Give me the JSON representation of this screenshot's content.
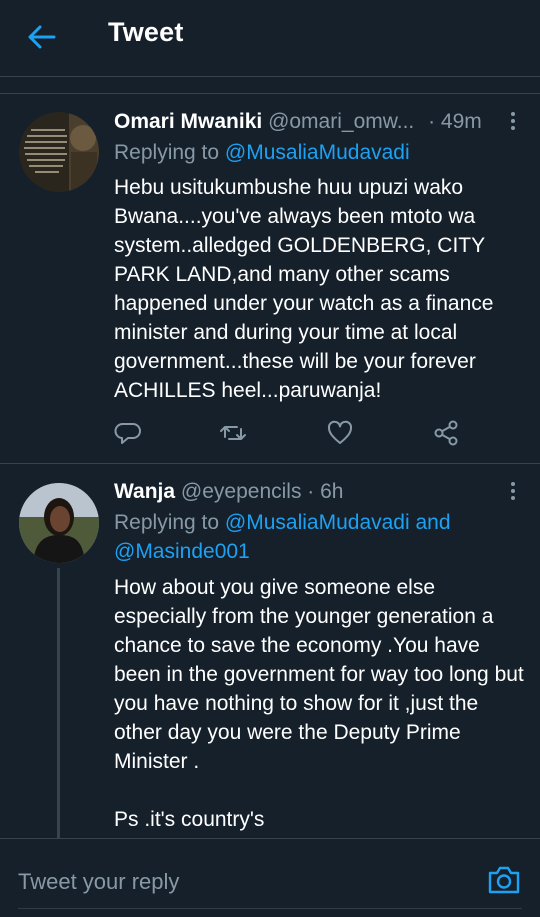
{
  "header": {
    "title": "Tweet",
    "back_icon": "arrow-left-icon"
  },
  "colors": {
    "background": "#15202b",
    "accent": "#1da1f2",
    "muted": "#8899a6",
    "divider": "#38444d"
  },
  "tweets": [
    {
      "name": "Omari Mwaniki",
      "handle": "@omari_omw...",
      "time": "· 49m",
      "replying_prefix": "Replying to ",
      "replying_to": "@MusaliaMudavadi",
      "replying_to_2": "",
      "body": "Hebu usitukumbushe huu upuzi wako Bwana....you've always been mtoto wa system..alledged GOLDENBERG, CITY PARK LAND,and many other scams happened under your watch as a finance minister and during your time at local government...these will be your forever ACHILLES heel...paruwanja!"
    },
    {
      "name": "Wanja",
      "handle": "@eyepencils",
      "time": "· 6h",
      "replying_prefix": "Replying to ",
      "replying_to": "@MusaliaMudavadi and",
      "replying_to_2": "@Masinde001",
      "body": "How about you give  someone else especially from the younger generation a chance to save the economy .You have been in the government for way too long but you have nothing to show for it ,just the other day you were the Deputy Prime Minister .\n\nPs .it's country's"
    }
  ],
  "composer": {
    "placeholder": "Tweet your reply",
    "camera_icon": "camera-icon"
  }
}
